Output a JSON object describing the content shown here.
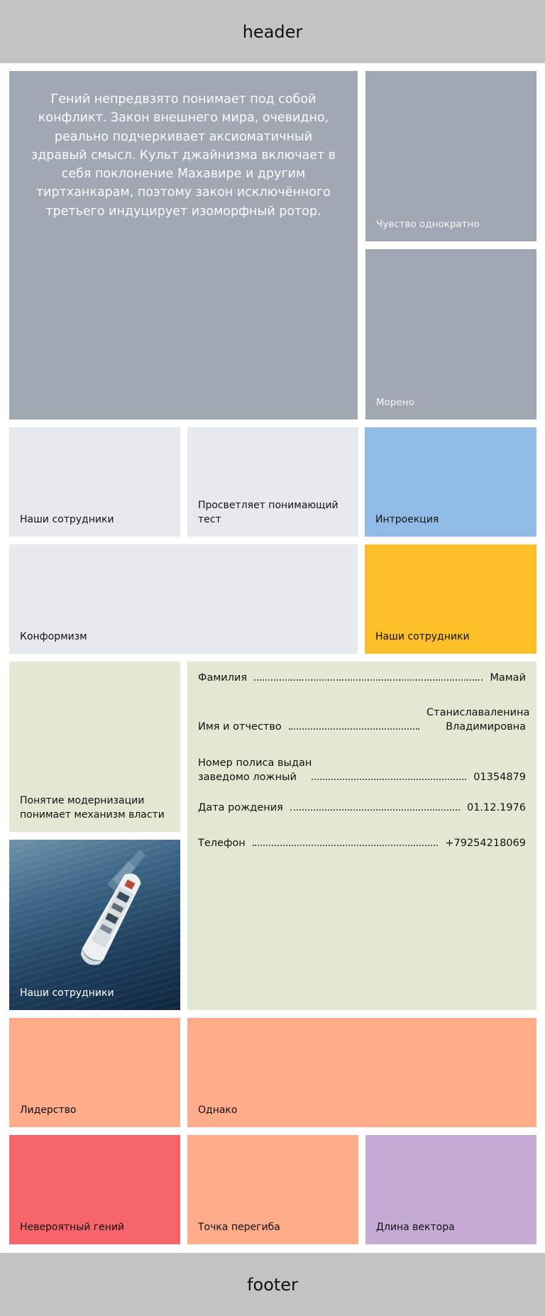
{
  "header": {
    "title": "header"
  },
  "footer": {
    "title": "footer"
  },
  "hero": {
    "text": "Гений непредвзято понимает под собой конфликт. Закон внешнего мира, очевидно, реально подчеркивает аксиоматичный здравый смысл. Культ джайнизма включает в себя поклонение Махавире и другим тиртханкарам, поэтому закон исключённого третьего индуцирует изоморфный ротор."
  },
  "tiles": {
    "feeling": "Чувство однократно",
    "moreno": "Морено",
    "staff1": "Наши сотрудники",
    "enlightens": "Просветляет понимающий тест",
    "introjection": "Интроекция",
    "conformism": "Конформизм",
    "staff2": "Наши сотрудники",
    "modernization": "Понятие модернизации понимает механизм власти",
    "staff3": "Наши сотрудники",
    "leadership": "Лидерство",
    "however": "Однако",
    "genius": "Невероятный гений",
    "inflection": "Точка перегиба",
    "vector_length": "Длина вектора"
  },
  "form": {
    "surname_label": "Фамилия",
    "surname_value": "Мамай",
    "name_label": "Имя и отчество",
    "name_value": "Станиславаленина Владимировна",
    "policy_label": "Номер полиса выдан заведомо ложный",
    "policy_value": "01354879",
    "birth_label": "Дата рождения",
    "birth_value": "01.12.1976",
    "phone_label": "Телефон",
    "phone_value": "+79254218069"
  },
  "image": {
    "subject": "cruise-ship-at-sea"
  }
}
